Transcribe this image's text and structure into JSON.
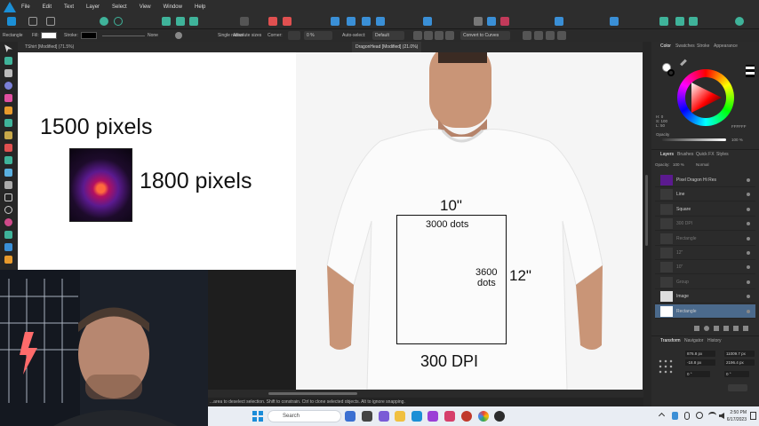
{
  "menubar": {
    "items": [
      "File",
      "Edit",
      "Text",
      "Layer",
      "Select",
      "View",
      "Window",
      "Help"
    ]
  },
  "contextbar": {
    "tool": "Rectangle",
    "fill_label": "Fill:",
    "stroke_label": "Stroke:",
    "stroke_value": "None",
    "single_radius": "Single radius",
    "absolute_sizes": "Absolute sizes",
    "corner_label": "Corner:",
    "corner_value": "0 %",
    "auto_select": "Auto-select:",
    "auto_select_value": "Default",
    "convert_button": "Convert to Curves"
  },
  "documents": {
    "tab_1": "TShirt [Modified] (71.5%)",
    "tab_2": "DragonHead [Modified] (21.0%)"
  },
  "canvas": {
    "width_label": "1500 pixels",
    "height_label": "1800 pixels",
    "shirt_width": "10\"",
    "shirt_height": "12\"",
    "dots_wide": "3000 dots",
    "dots_tall_1": "3600",
    "dots_tall_2": "dots",
    "dpi": "300 DPI"
  },
  "panel": {
    "tabs_top": [
      "Color",
      "Swatches",
      "Stroke",
      "Appearance"
    ],
    "hex": "FFFFFF",
    "opacity_label": "Opacity",
    "opacity_value": "100 %",
    "hsl": [
      "H: 0",
      "S: 100",
      "L: 50"
    ],
    "tabs_mid": [
      "Layers",
      "Brushes",
      "Quick FX",
      "Styles"
    ],
    "layer_opacity_label": "Opacity:",
    "layer_opacity": "100 %",
    "blend_mode": "Normal",
    "layers": [
      {
        "name": "Pixel Dragon Hi Res",
        "dim": false,
        "selected": false
      },
      {
        "name": "Line",
        "dim": false,
        "selected": false
      },
      {
        "name": "Square",
        "dim": false,
        "selected": false
      },
      {
        "name": "300 DPI",
        "dim": true,
        "selected": false
      },
      {
        "name": "Rectangle",
        "dim": true,
        "selected": false
      },
      {
        "name": "12\"",
        "dim": true,
        "selected": false
      },
      {
        "name": "10\"",
        "dim": true,
        "selected": false
      },
      {
        "name": "Group",
        "dim": true,
        "selected": false
      },
      {
        "name": "Image",
        "dim": false,
        "selected": false
      },
      {
        "name": "Rectangle",
        "dim": false,
        "selected": true
      }
    ],
    "tabs_bottom": [
      "Transform",
      "Navigator",
      "History"
    ],
    "transform": {
      "x": "876.8 px",
      "y": "-18.8 px",
      "w": "11009.7 px",
      "h": "2196.4 px",
      "r": "0 °",
      "s": "0 °"
    }
  },
  "status": {
    "hint": "...area to deselect selection. Shift to constrain. Ctrl to clone selected objects. Alt to ignore snapping."
  },
  "taskbar": {
    "search": "Search",
    "time": "2:50 PM",
    "date": "6/17/2023"
  }
}
